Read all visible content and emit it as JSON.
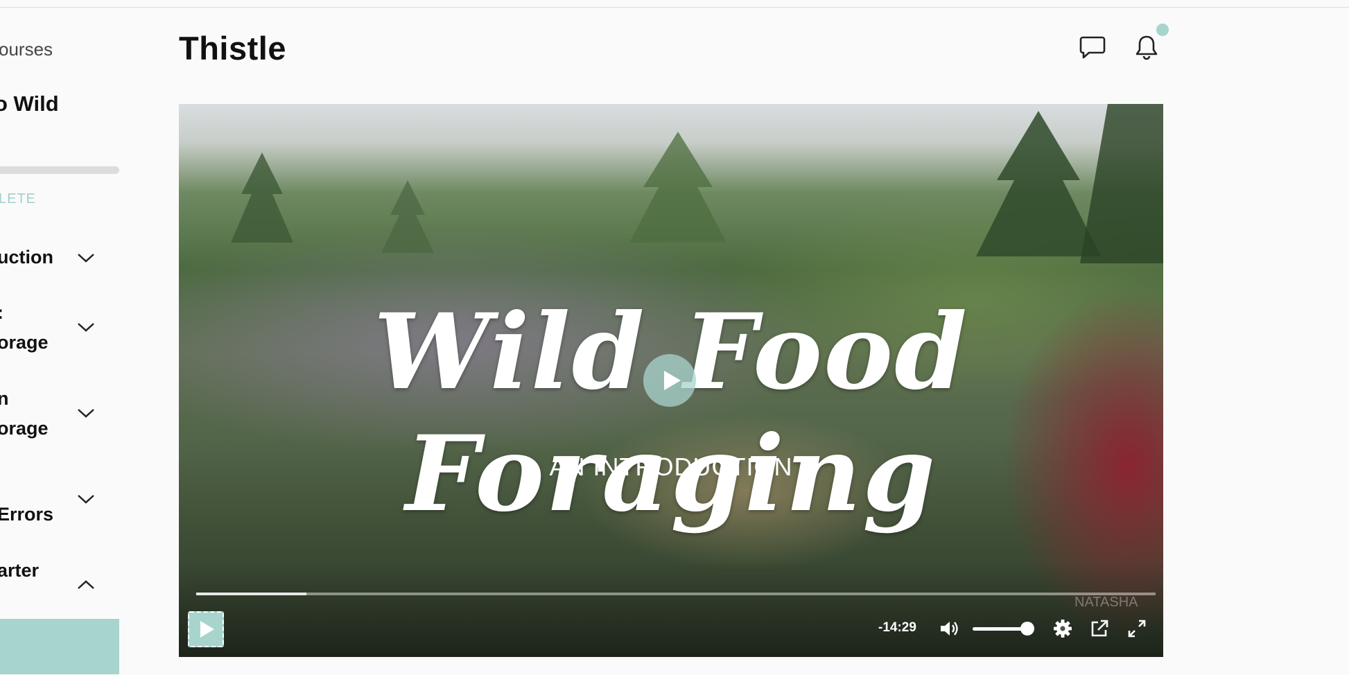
{
  "sidebar": {
    "back_label": "ourses",
    "course_title": "o Wild",
    "progress_fraction": 0.0,
    "complete_label": "LETE",
    "items": [
      {
        "label": "uction",
        "expanded": false
      },
      {
        "label": ":\norage",
        "expanded": false
      },
      {
        "label": "n\norage",
        "expanded": false
      },
      {
        "label": "\nErrors",
        "expanded": false
      },
      {
        "label": "arter",
        "expanded": true
      }
    ]
  },
  "header": {
    "title": "Thistle",
    "icons": [
      "chat-icon",
      "bell-icon"
    ],
    "notification_dot_color": "#a8d4ce"
  },
  "video": {
    "title_script": "Wild Food Foraging",
    "subtitle": "AN INTRODUCTION",
    "watermark": "NATASHA",
    "time_remaining": "-14:29",
    "progress_fraction": 0.115,
    "volume_fraction": 0.92,
    "accent_color": "#a8d4ce",
    "controls": [
      "play-icon",
      "volume-icon",
      "settings-icon",
      "popout-icon",
      "fullscreen-icon"
    ]
  }
}
